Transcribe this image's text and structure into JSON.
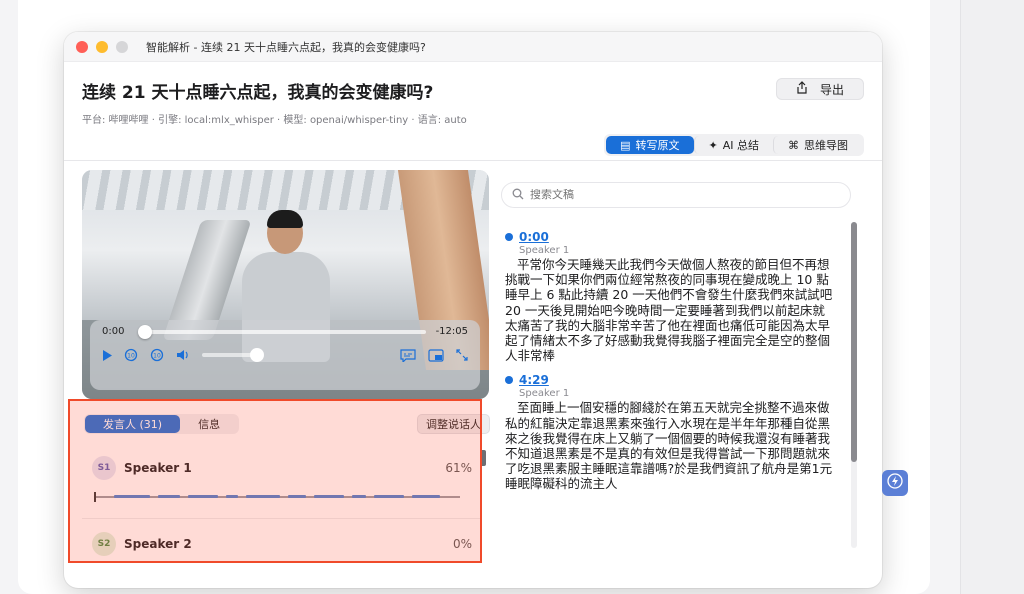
{
  "window": {
    "title": "智能解析 - 连续 21 天十点睡六点起，我真的会变健康吗?"
  },
  "header": {
    "title": "连续 21 天十点睡六点起，我真的会变健康吗?",
    "meta": "平台: 哔哩哔哩 · 引擎: local:mlx_whisper · 模型: openai/whisper-tiny · 语言: auto",
    "export_label": "导出"
  },
  "view_tabs": [
    {
      "label": "转写原文",
      "icon": "document-icon",
      "active": true
    },
    {
      "label": "AI 总结",
      "icon": "sparkle-icon",
      "active": false
    },
    {
      "label": "思维导图",
      "icon": "command-icon",
      "active": false
    }
  ],
  "player": {
    "current_time": "0:00",
    "remaining_time": "-12:05",
    "progress": 0.0,
    "volume": 0.95
  },
  "search": {
    "placeholder": "搜索文稿",
    "value": ""
  },
  "transcript": [
    {
      "time": "0:00",
      "speaker": "Speaker 1",
      "text": "平常你今天睡幾天此我們今天做個人熬夜的節目但不再想挑戰一下如果你們兩位經常熬夜的同事現在變成晚上 10 點睡早上 6 點此持續 20 一天他們不會發生什麼我們來試試吧 20 一天後見開始吧今晚時間一定要睡著到我們以前起床就太痛苦了我的大腦非常辛苦了他在裡面也痛低可能因為太早起了情緒太不多了好感動我覺得我腦子裡面完全是空的整個人非常棒"
    },
    {
      "time": "4:29",
      "speaker": "Speaker 1",
      "text": "至面睡上一個安穩的腳綫於在第五天就完全挑整不過來做私的紅龍決定靠退黑素來強行入水現在是半年年那種自從黑來之後我覺得在床上又躺了一個個要的時候我還沒有睡著我不知道退黑素是不是真的有效但是我得嘗試一下那問題就來了吃退黑素服主睡眠這靠譜嗎?於是我們資訊了航舟是第1元睡眠障礙科的流主人"
    }
  ],
  "speaker_panel": {
    "tabs": [
      {
        "label": "发言人 (31)",
        "active": true
      },
      {
        "label": "信息",
        "active": false
      }
    ],
    "adjust_label": "调整说话人",
    "speakers": [
      {
        "badge": "S1",
        "name": "Speaker 1",
        "percent": "61%",
        "badge_bg": "#e4e4f4",
        "badge_fg": "#5b5bb0"
      },
      {
        "badge": "S2",
        "name": "Speaker 2",
        "percent": "0%",
        "badge_bg": "#dff0dc",
        "badge_fg": "#4a8a44"
      }
    ]
  },
  "colors": {
    "accent": "#1a6fd8",
    "highlight_border": "#f04a2a"
  }
}
